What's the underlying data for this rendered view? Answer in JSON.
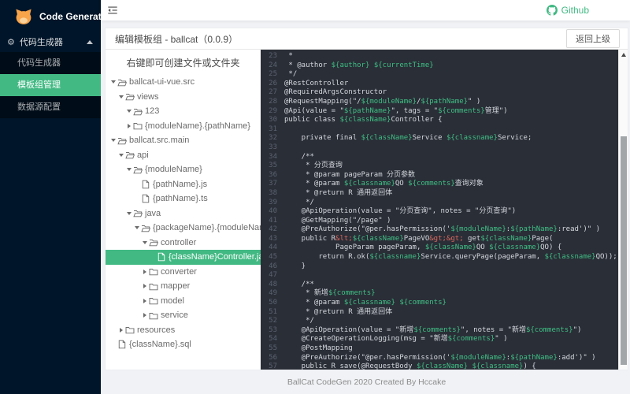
{
  "sidebar": {
    "logo_text": "Code Generator",
    "parent_label": "代码生成器",
    "submenu": [
      {
        "label": "代码生成器",
        "selected": false
      },
      {
        "label": "模板组管理",
        "selected": true
      },
      {
        "label": "数据源配置",
        "selected": false
      }
    ]
  },
  "header": {
    "github": "Github"
  },
  "panel": {
    "title": "编辑模板组 - ballcat（0.0.9）",
    "back_button": "返回上级"
  },
  "tree": {
    "hint": "右键即可创建文件或文件夹",
    "nodes": [
      {
        "level": 0,
        "state": "open",
        "icon": "folder-open",
        "label": "ballcat-ui-vue.src",
        "selected": false
      },
      {
        "level": 1,
        "state": "open",
        "icon": "folder-open",
        "label": "views",
        "selected": false
      },
      {
        "level": 2,
        "state": "open",
        "icon": "folder-open",
        "label": "123",
        "selected": false
      },
      {
        "level": 2,
        "state": "closed",
        "icon": "folder",
        "label": "{moduleName}.{pathName}",
        "selected": false
      },
      {
        "level": 0,
        "state": "open",
        "icon": "folder-open",
        "label": "ballcat.src.main",
        "selected": false
      },
      {
        "level": 1,
        "state": "open",
        "icon": "folder-open",
        "label": "api",
        "selected": false
      },
      {
        "level": 2,
        "state": "open",
        "icon": "folder-open",
        "label": "{moduleName}",
        "selected": false
      },
      {
        "level": 3,
        "state": "leaf",
        "icon": "file",
        "label": "{pathName}.js",
        "selected": false
      },
      {
        "level": 3,
        "state": "leaf",
        "icon": "file",
        "label": "{pathName}.ts",
        "selected": false
      },
      {
        "level": 2,
        "state": "open",
        "icon": "folder-open",
        "label": "java",
        "selected": false
      },
      {
        "level": 3,
        "state": "open",
        "icon": "folder-open",
        "label": "{packageName}.{moduleName}",
        "selected": false
      },
      {
        "level": 4,
        "state": "open",
        "icon": "folder-open",
        "label": "controller",
        "selected": false
      },
      {
        "level": 5,
        "state": "leaf",
        "icon": "file",
        "label": "{className}Controller.java",
        "selected": true
      },
      {
        "level": 4,
        "state": "closed",
        "icon": "folder",
        "label": "converter",
        "selected": false
      },
      {
        "level": 4,
        "state": "closed",
        "icon": "folder",
        "label": "mapper",
        "selected": false
      },
      {
        "level": 4,
        "state": "closed",
        "icon": "folder",
        "label": "model",
        "selected": false
      },
      {
        "level": 4,
        "state": "closed",
        "icon": "folder",
        "label": "service",
        "selected": false
      },
      {
        "level": 1,
        "state": "closed",
        "icon": "folder",
        "label": "resources",
        "selected": false
      },
      {
        "level": 0,
        "state": "leaf",
        "icon": "file",
        "label": "{className}.sql",
        "selected": false
      }
    ]
  },
  "editor": {
    "lines": [
      {
        "n": 23,
        "seg": [
          [
            "p",
            " *"
          ]
        ]
      },
      {
        "n": 24,
        "seg": [
          [
            "p",
            " * @author "
          ],
          [
            "g",
            "${author}"
          ],
          [
            "p",
            " "
          ],
          [
            "g",
            "${currentTime}"
          ]
        ]
      },
      {
        "n": 25,
        "seg": [
          [
            "p",
            " */"
          ]
        ]
      },
      {
        "n": 26,
        "seg": [
          [
            "p",
            "@RestController"
          ]
        ]
      },
      {
        "n": 27,
        "seg": [
          [
            "p",
            "@RequiredArgsConstructor"
          ]
        ]
      },
      {
        "n": 28,
        "seg": [
          [
            "p",
            "@RequestMapping(\"/"
          ],
          [
            "g",
            "${moduleName}"
          ],
          [
            "p",
            "/"
          ],
          [
            "g",
            "${pathName}"
          ],
          [
            "p",
            "\" )"
          ]
        ]
      },
      {
        "n": 29,
        "seg": [
          [
            "p",
            "@Api(value = \""
          ],
          [
            "g",
            "${pathName}"
          ],
          [
            "p",
            "\", tags = \""
          ],
          [
            "g",
            "${comments}"
          ],
          [
            "p",
            "管理\")"
          ]
        ]
      },
      {
        "n": 30,
        "seg": [
          [
            "p",
            "public class "
          ],
          [
            "g",
            "${className}"
          ],
          [
            "p",
            "Controller {"
          ]
        ]
      },
      {
        "n": 31,
        "seg": []
      },
      {
        "n": 32,
        "seg": [
          [
            "p",
            "    private final "
          ],
          [
            "g",
            "${className}"
          ],
          [
            "p",
            "Service "
          ],
          [
            "g",
            "${classname}"
          ],
          [
            "p",
            "Service;"
          ]
        ]
      },
      {
        "n": 33,
        "seg": []
      },
      {
        "n": 34,
        "seg": [
          [
            "p",
            "    /**"
          ]
        ]
      },
      {
        "n": 35,
        "seg": [
          [
            "p",
            "     * 分页查询"
          ]
        ]
      },
      {
        "n": 36,
        "seg": [
          [
            "p",
            "     * @param pageParam 分页参数"
          ]
        ]
      },
      {
        "n": 37,
        "seg": [
          [
            "p",
            "     * @param "
          ],
          [
            "g",
            "${classname}"
          ],
          [
            "p",
            "QO "
          ],
          [
            "g",
            "${comments}"
          ],
          [
            "p",
            "查询对象"
          ]
        ]
      },
      {
        "n": 38,
        "seg": [
          [
            "p",
            "     * @return R 通用返回体"
          ]
        ]
      },
      {
        "n": 39,
        "seg": [
          [
            "p",
            "     */"
          ]
        ]
      },
      {
        "n": 40,
        "seg": [
          [
            "p",
            "    @ApiOperation(value = \"分页查询\", notes = \"分页查询\")"
          ]
        ]
      },
      {
        "n": 41,
        "seg": [
          [
            "p",
            "    @GetMapping(\"/page\" )"
          ]
        ]
      },
      {
        "n": 42,
        "seg": [
          [
            "p",
            "    @PreAuthorize(\"@per.hasPermission('"
          ],
          [
            "g",
            "${moduleName}"
          ],
          [
            "p",
            ":"
          ],
          [
            "g",
            "${pathName}"
          ],
          [
            "p",
            ":read')\" )"
          ]
        ]
      },
      {
        "n": 43,
        "seg": [
          [
            "p",
            "    public R"
          ],
          [
            "r",
            "&lt;"
          ],
          [
            "g",
            "${className}"
          ],
          [
            "p",
            "PageVO"
          ],
          [
            "r",
            "&gt;&gt;"
          ],
          [
            "p",
            " get"
          ],
          [
            "g",
            "${className}"
          ],
          [
            "p",
            "Page("
          ]
        ]
      },
      {
        "n": 44,
        "seg": [
          [
            "p",
            "            PageParam pageParam, "
          ],
          [
            "g",
            "${className}"
          ],
          [
            "p",
            "QO "
          ],
          [
            "g",
            "${classname}"
          ],
          [
            "p",
            "QO) {"
          ]
        ]
      },
      {
        "n": 45,
        "seg": [
          [
            "p",
            "        return R.ok("
          ],
          [
            "g",
            "${classname}"
          ],
          [
            "p",
            "Service.queryPage(pageParam, "
          ],
          [
            "g",
            "${classname}"
          ],
          [
            "p",
            "QO));"
          ]
        ]
      },
      {
        "n": 46,
        "seg": [
          [
            "p",
            "    }"
          ]
        ]
      },
      {
        "n": 47,
        "seg": []
      },
      {
        "n": 48,
        "seg": [
          [
            "p",
            "    /**"
          ]
        ]
      },
      {
        "n": 49,
        "seg": [
          [
            "p",
            "     * 新增"
          ],
          [
            "g",
            "${comments}"
          ]
        ]
      },
      {
        "n": 50,
        "seg": [
          [
            "p",
            "     * @param "
          ],
          [
            "g",
            "${classname}"
          ],
          [
            "p",
            " "
          ],
          [
            "g",
            "${comments}"
          ]
        ]
      },
      {
        "n": 51,
        "seg": [
          [
            "p",
            "     * @return R 通用返回体"
          ]
        ]
      },
      {
        "n": 52,
        "seg": [
          [
            "p",
            "     */"
          ]
        ]
      },
      {
        "n": 53,
        "seg": [
          [
            "p",
            "    @ApiOperation(value = \"新增"
          ],
          [
            "g",
            "${comments}"
          ],
          [
            "p",
            "\", notes = \"新增"
          ],
          [
            "g",
            "${comments}"
          ],
          [
            "p",
            "\")"
          ]
        ]
      },
      {
        "n": 54,
        "seg": [
          [
            "p",
            "    @CreateOperationLogging(msg = \"新增"
          ],
          [
            "g",
            "${comments}"
          ],
          [
            "p",
            "\" )"
          ]
        ]
      },
      {
        "n": 55,
        "seg": [
          [
            "p",
            "    @PostMapping"
          ]
        ]
      },
      {
        "n": 56,
        "seg": [
          [
            "p",
            "    @PreAuthorize(\"@per.hasPermission('"
          ],
          [
            "g",
            "${moduleName}"
          ],
          [
            "p",
            ":"
          ],
          [
            "g",
            "${pathName}"
          ],
          [
            "p",
            ":add')\" )"
          ]
        ]
      },
      {
        "n": 57,
        "seg": [
          [
            "p",
            "    public R save(@RequestBody "
          ],
          [
            "g",
            "${className}"
          ],
          [
            "p",
            " "
          ],
          [
            "g",
            "${classname}"
          ],
          [
            "p",
            ") {"
          ]
        ]
      }
    ]
  },
  "footer": {
    "text": "BallCat CodeGen 2020 Created By Hccake"
  },
  "colors": {
    "accent_green": "#42b983",
    "sidebar_bg": "#001529",
    "submenu_bg": "#000c17",
    "logo_orange": "#f8a44a",
    "page_bg": "#f0f2f5",
    "editor_bg": "#2a2e37",
    "editor_text": "#d4d7dd",
    "editor_var_green": "#3fbe84",
    "editor_entity_red": "#d9685f"
  }
}
